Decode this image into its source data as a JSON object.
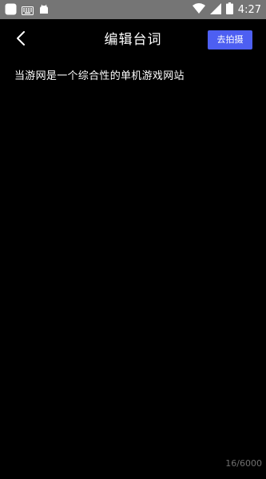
{
  "status_bar": {
    "time": "4:27",
    "background": "#757575",
    "left_icons": [
      "app-notification-icon",
      "keyboard-icon",
      "android-icon"
    ],
    "right_icons": [
      "wifi-icon",
      "signal-icon",
      "battery-icon"
    ]
  },
  "header": {
    "back_icon": "chevron-left-icon",
    "title": "编辑台词",
    "action_label": "去拍摄",
    "action_color": "#4d5ff2"
  },
  "editor": {
    "text": "当游网是一个综合性的单机游戏网站",
    "char_count": "16/6000"
  }
}
